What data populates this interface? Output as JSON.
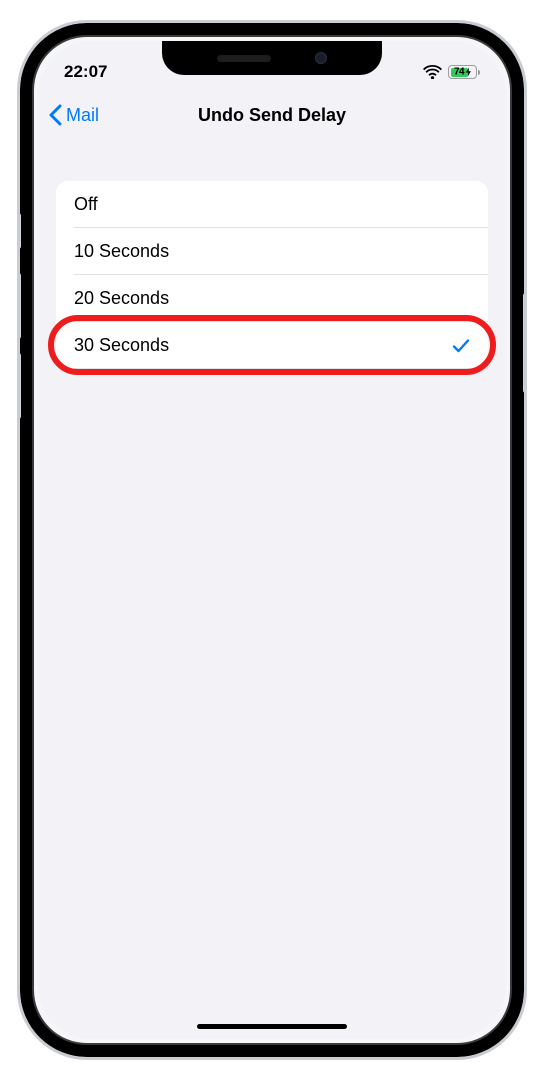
{
  "status_bar": {
    "time": "22:07",
    "battery_percent": "74"
  },
  "nav": {
    "back_label": "Mail",
    "title": "Undo Send Delay"
  },
  "options": [
    {
      "label": "Off",
      "selected": false,
      "highlighted": false
    },
    {
      "label": "10 Seconds",
      "selected": false,
      "highlighted": false
    },
    {
      "label": "20 Seconds",
      "selected": false,
      "highlighted": false
    },
    {
      "label": "30 Seconds",
      "selected": true,
      "highlighted": true
    }
  ],
  "colors": {
    "accent": "#007aff",
    "battery_green": "#34c759",
    "highlight_red": "#ee1c1c"
  }
}
